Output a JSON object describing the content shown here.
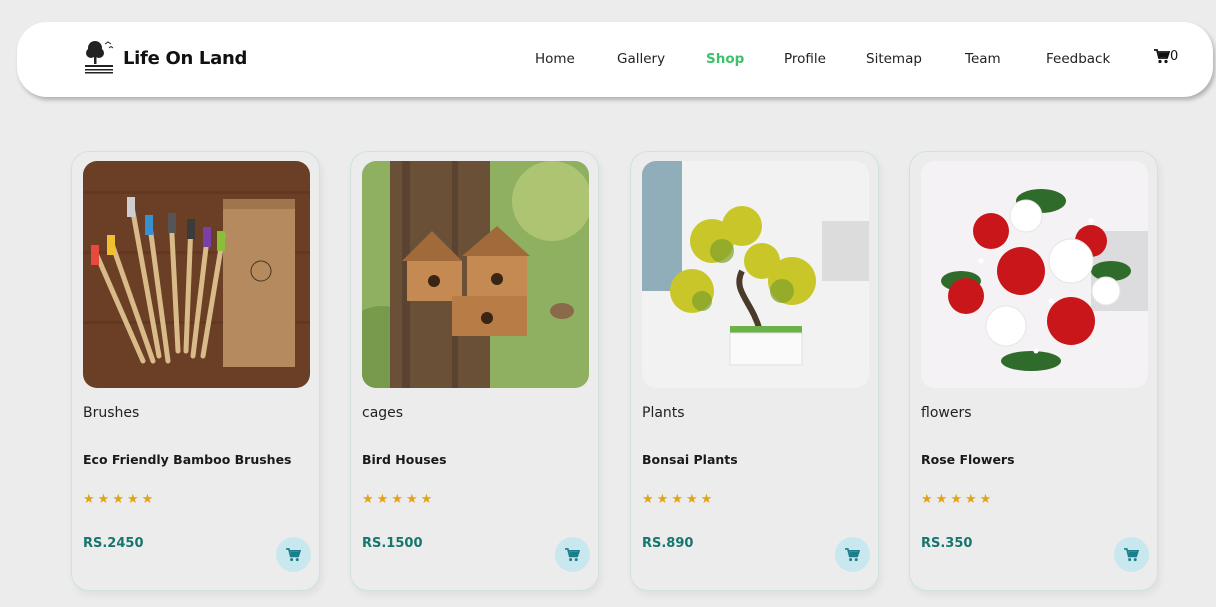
{
  "brand": {
    "name": "Life On Land",
    "icon": "tree-logo-icon"
  },
  "nav": {
    "items": [
      "Home",
      "Gallery",
      "Shop",
      "Profile",
      "Sitemap",
      "Team",
      "Feedback"
    ],
    "active": "Shop",
    "cart_count": "0"
  },
  "colors": {
    "active_nav": "#3cc36a",
    "price": "#16756d",
    "star": "#e3a21a",
    "cart_button_bg": "#c9e7ef"
  },
  "products": [
    {
      "category": "Brushes",
      "name": "Eco Friendly Bamboo Brushes",
      "rating": 5,
      "price": "RS.2450",
      "image": "bamboo-toothbrushes-image"
    },
    {
      "category": "cages",
      "name": "Bird Houses",
      "rating": 5,
      "price": "RS.1500",
      "image": "wooden-bird-house-image"
    },
    {
      "category": "Plants",
      "name": "Bonsai Plants",
      "rating": 5,
      "price": "RS.890",
      "image": "bonsai-plant-image"
    },
    {
      "category": "flowers",
      "name": "Rose Flowers",
      "rating": 5,
      "price": "RS.350",
      "image": "rose-bouquet-image"
    }
  ]
}
